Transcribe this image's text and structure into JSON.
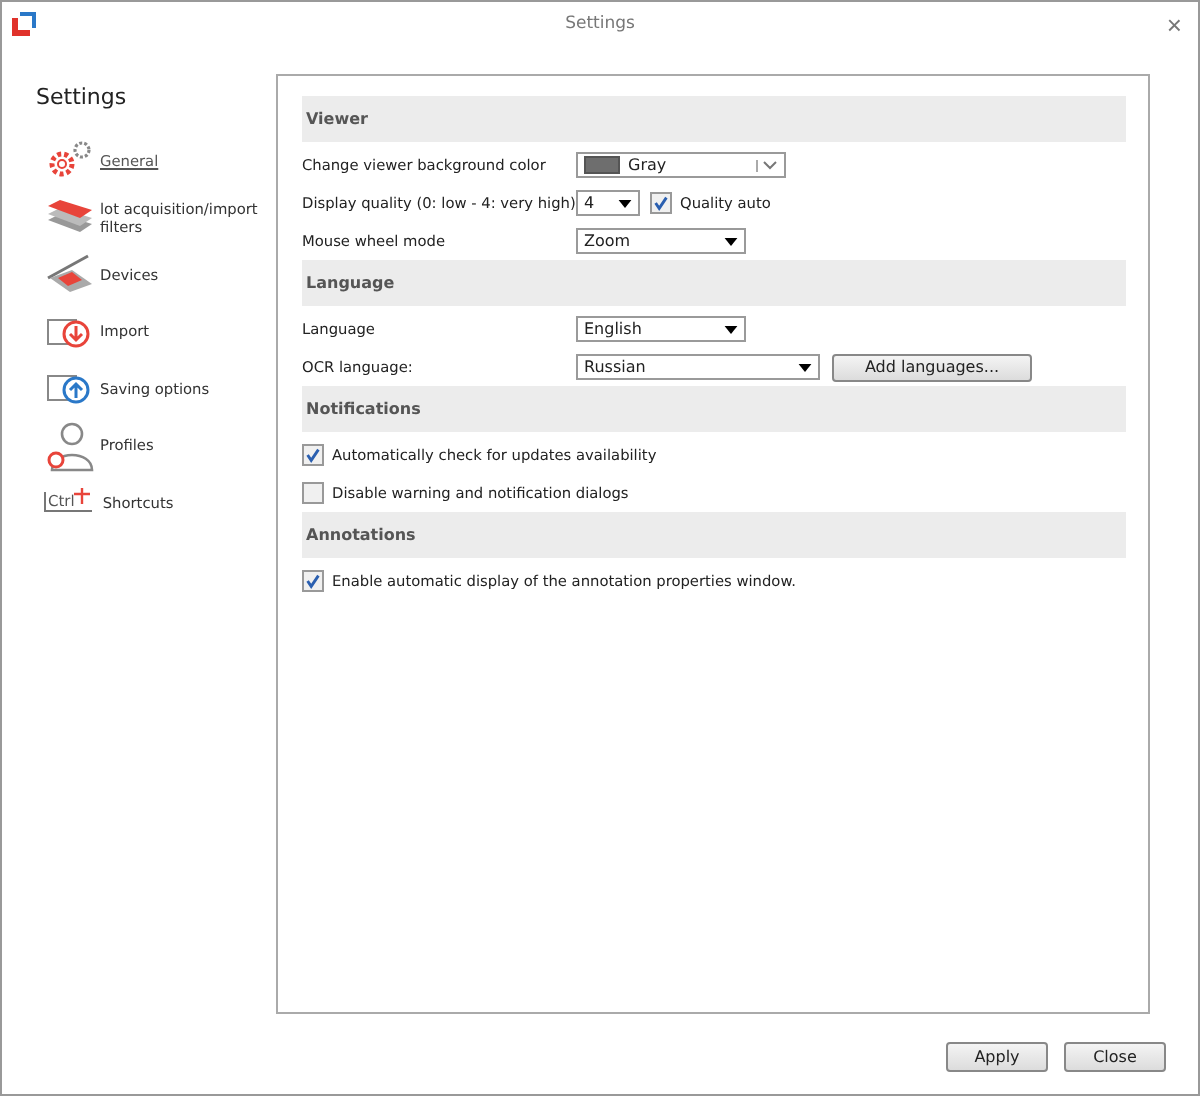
{
  "window": {
    "title": "Settings",
    "close": "×"
  },
  "sidebar": {
    "title": "Settings",
    "items": [
      {
        "label": "General",
        "selected": true
      },
      {
        "label": "lot acquisition/import filters",
        "selected": false
      },
      {
        "label": "Devices",
        "selected": false
      },
      {
        "label": "Import",
        "selected": false
      },
      {
        "label": "Saving options",
        "selected": false
      },
      {
        "label": "Profiles",
        "selected": false
      },
      {
        "label": "Shortcuts",
        "selected": false,
        "icon_text": "Ctrl"
      }
    ]
  },
  "sections": [
    {
      "title": "Viewer",
      "rows": [
        {
          "kind": "select",
          "label": "Change viewer background color",
          "value": "Gray",
          "color": "#6e6e6e"
        },
        {
          "kind": "select",
          "label": "Display quality (0: low - 4: very high)",
          "value": "4",
          "checkbox": {
            "label": "Quality auto",
            "checked": true
          }
        },
        {
          "kind": "select",
          "label": "Mouse wheel mode",
          "value": "Zoom"
        }
      ]
    },
    {
      "title": "Language",
      "rows": [
        {
          "kind": "select",
          "label": "Language",
          "value": "English"
        },
        {
          "kind": "select",
          "label": "OCR language:",
          "value": "Russian",
          "button": "Add languages..."
        }
      ]
    },
    {
      "title": "Notifications",
      "rows": [
        {
          "kind": "check",
          "label": "Automatically check for updates availability",
          "checked": true
        },
        {
          "kind": "check",
          "label": "Disable warning and notification dialogs",
          "checked": false
        }
      ]
    },
    {
      "title": "Annotations",
      "rows": [
        {
          "kind": "check",
          "label": "Enable automatic display of the annotation properties window.",
          "checked": true
        }
      ]
    }
  ],
  "buttons": [
    "Apply",
    "Close"
  ]
}
